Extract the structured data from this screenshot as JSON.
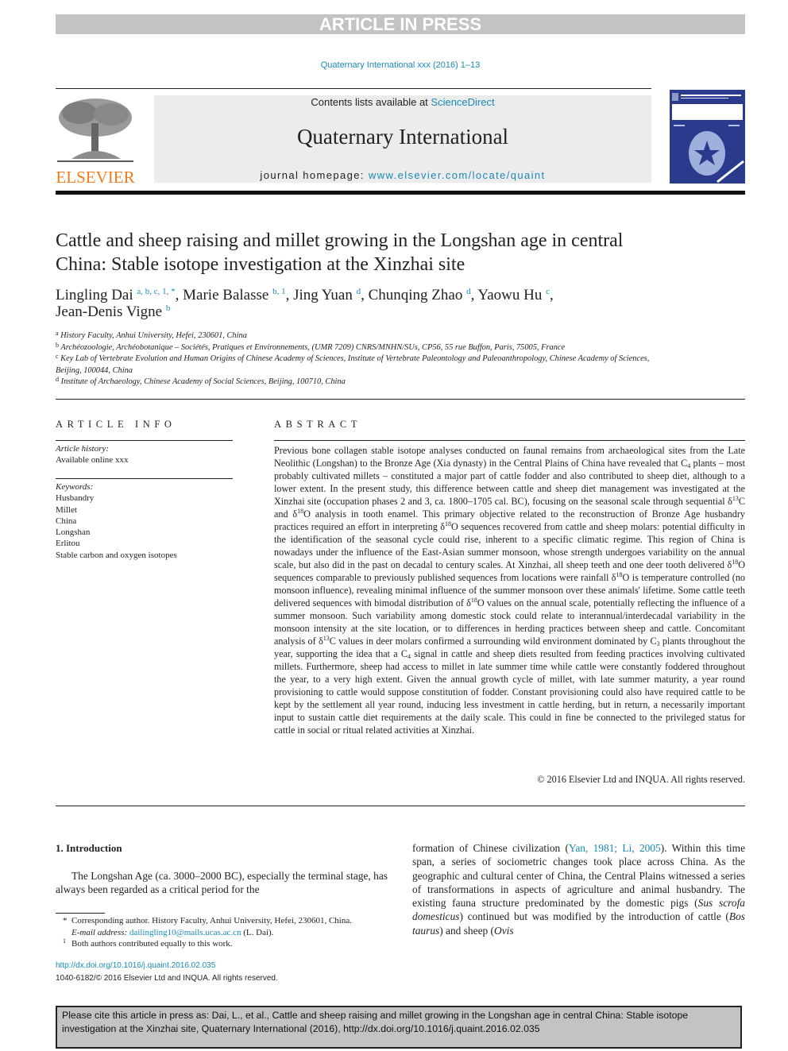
{
  "banner": {
    "label": "ARTICLE IN PRESS"
  },
  "journal_ref": "Quaternary International xxx (2016) 1–13",
  "header": {
    "publisher_logo_text": "ELSEVIER",
    "contents_prefix": "Contents lists available at ",
    "contents_link": "ScienceDirect",
    "journal_title": "Quaternary International",
    "homepage_prefix": "journal homepage: ",
    "homepage_link": "www.elsevier.com/locate/quaint"
  },
  "article": {
    "title": "Cattle and sheep raising and millet growing in the Longshan age in central China: Stable isotope investigation at the Xinzhai site",
    "authors": [
      {
        "name": "Lingling Dai",
        "marks": "a, b, c, 1, *"
      },
      {
        "name": "Marie Balasse",
        "marks": "b, 1"
      },
      {
        "name": "Jing Yuan",
        "marks": "d"
      },
      {
        "name": "Chunqing Zhao",
        "marks": "d"
      },
      {
        "name": "Yaowu Hu",
        "marks": "c"
      },
      {
        "name": "Jean-Denis Vigne",
        "marks": "b"
      }
    ],
    "affiliations": [
      {
        "mark": "a",
        "text": "History Faculty, Anhui University, Hefei, 230601, China"
      },
      {
        "mark": "b",
        "text": "Archéozoologie, Archéobotanique – Sociétés, Pratiques et Environnements, (UMR 7209) CNRS/MNHN/SUs, CP56, 55 rue Buffon, Paris, 75005, France"
      },
      {
        "mark": "c",
        "text": "Key Lab of Vertebrate Evolution and Human Origins of Chinese Academy of Sciences, Institute of Vertebrate Paleontology and Paleoanthropology, Chinese Academy of Sciences, Beijing, 100044, China"
      },
      {
        "mark": "d",
        "text": "Institute of Archaeology, Chinese Academy of Social Sciences, Beijing, 100710, China"
      }
    ]
  },
  "article_info": {
    "heading": "ARTICLE INFO",
    "history_label": "Article history:",
    "history_value": "Available online xxx",
    "keywords_label": "Keywords:",
    "keywords": [
      "Husbandry",
      "Millet",
      "China",
      "Longshan",
      "Erlitou",
      "Stable carbon and oxygen isotopes"
    ]
  },
  "abstract": {
    "heading": "ABSTRACT",
    "p1": "Previous bone collagen stable isotope analyses conducted on faunal remains from archaeological sites from the Late Neolithic (Longshan) to the Bronze Age (Xia dynasty) in the Central Plains of China have revealed that C",
    "p2": " plants – most probably cultivated millets – constituted a major part of cattle fodder and also contributed to sheep diet, although to a lower extent. In the present study, this difference between cattle and sheep diet management was investigated at the Xinzhai site (occupation phases 2 and 3, ca. 1800–1705 cal. BC), focusing on the seasonal scale through sequential δ",
    "p3": "C and δ",
    "p4": "O analysis in tooth enamel. This primary objective related to the reconstruction of Bronze Age husbandry practices required an effort in interpreting δ",
    "p5": "O sequences recovered from cattle and sheep molars: potential difficulty in the identification of the seasonal cycle could rise, inherent to a specific climatic regime. This region of China is nowadays under the influence of the East-Asian summer monsoon, whose strength undergoes variability on the annual scale, but also did in the past on decadal to century scales. At Xinzhai, all sheep teeth and one deer tooth delivered δ",
    "p6": "O sequences comparable to previously published sequences from locations were rainfall δ",
    "p7": "O is temperature controlled (no monsoon influence), revealing minimal influence of the summer monsoon over these animals' lifetime. Some cattle teeth delivered sequences with bimodal distribution of δ",
    "p8": "O values on the annual scale, potentially reflecting the influence of a summer monsoon. Such variability among domestic stock could relate to interannual/interdecadal variability in the monsoon intensity at the site location, or to differences in herding practices between sheep and cattle. Concomitant analysis of δ",
    "p9": "C values in deer molars confirmed a surrounding wild environment dominated by C",
    "p10": " plants throughout the year, supporting the idea that a C",
    "p11": " signal in cattle and sheep diets resulted from feeding practices involving cultivated millets. Furthermore, sheep had access to millet in late summer time while cattle were constantly foddered throughout the year, to a very high extent. Given the annual growth cycle of millet, with late summer maturity, a year round provisioning to cattle would suppose constitution of fodder. Constant provisioning could also have required cattle to be kept by the settlement all year round, inducing less investment in cattle herding, but in return, a necessarily important input to sustain cattle diet requirements at the daily scale. This could in fine be connected to the privileged status for cattle in social or ritual related activities at Xinzhai.",
    "sub4": "4",
    "sub3": "3",
    "sup13": "13",
    "sup18": "18",
    "copyright": "© 2016 Elsevier Ltd and INQUA. All rights reserved."
  },
  "introduction": {
    "heading": "1.  Introduction",
    "left_text": "The Longshan Age (ca. 3000–2000 BC), especially the terminal stage, has always been regarded as a critical period for the",
    "right_a": "formation of Chinese civilization (",
    "right_cite": "Yan, 1981; Li, 2005",
    "right_b": "). Within this time span, a series of sociometric changes took place across China. As the geographic and cultural center of China, the Central Plains witnessed a series of transformations in aspects of agriculture and animal husbandry. The existing fauna structure predominated by the domestic pigs (",
    "species_pig": "Sus scrofa domesticus",
    "right_c": ") continued but was modified by the introduction of cattle (",
    "species_cattle": "Bos taurus",
    "right_d": ") and sheep (",
    "species_sheep": "Ovis"
  },
  "footnotes": {
    "corresponding_mark": "*",
    "corresponding_text": "Corresponding author. History Faculty, Anhui University, Hefei, 230601, China.",
    "email_label": "E-mail address: ",
    "email": "dailingling10@mails.ucas.ac.cn",
    "email_suffix": " (L. Dai).",
    "equal_mark": "1",
    "equal_text": "Both authors contributed equally to this work."
  },
  "doi": "http://dx.doi.org/10.1016/j.quaint.2016.02.035",
  "issn_line": "1040-6182/© 2016 Elsevier Ltd and INQUA. All rights reserved.",
  "cite_box": "Please cite this article in press as: Dai, L., et al., Cattle and sheep raising and millet growing in the Longshan age in central China: Stable isotope investigation at the Xinzhai site, Quaternary International (2016), http://dx.doi.org/10.1016/j.quaint.2016.02.035",
  "colors": {
    "link": "#1a8ab5",
    "publisher_orange": "#f07c1b",
    "banner_gray": "#c3c3c3",
    "cover_blue": "#2a3a8c"
  }
}
